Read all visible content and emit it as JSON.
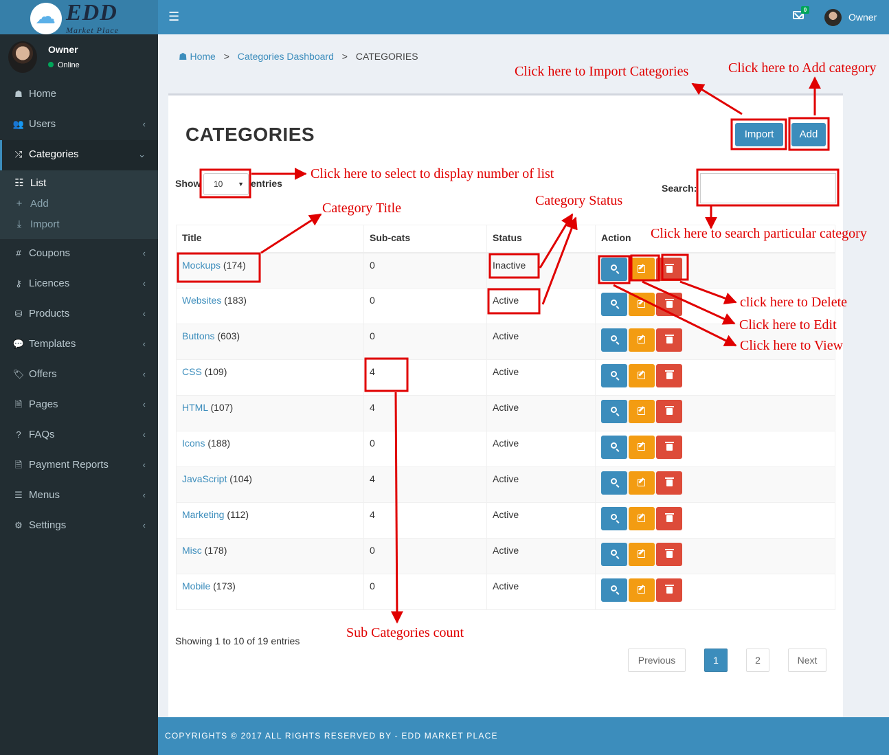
{
  "brand": {
    "main": "EDD",
    "sub": "Market Place"
  },
  "user": {
    "name": "Owner",
    "status": "Online"
  },
  "header": {
    "menu_icon": "hamburger-icon",
    "notification_count": "0",
    "user_name": "Owner"
  },
  "sidebar": {
    "items": [
      {
        "label": "Home",
        "icon": "home-icon",
        "glyph": "☗",
        "chevron": ""
      },
      {
        "label": "Users",
        "icon": "users-icon",
        "glyph": "👥",
        "chevron": "‹"
      },
      {
        "label": "Categories",
        "icon": "shuffle-icon",
        "glyph": "⤮",
        "chevron": "⌄"
      },
      {
        "label": "Coupons",
        "icon": "hashtag-icon",
        "glyph": "#",
        "chevron": "‹"
      },
      {
        "label": "Licences",
        "icon": "key-icon",
        "glyph": "⚷",
        "chevron": "‹"
      },
      {
        "label": "Products",
        "icon": "shopping-bag-icon",
        "glyph": "⛁",
        "chevron": "‹"
      },
      {
        "label": "Templates",
        "icon": "comment-icon",
        "glyph": "💬",
        "chevron": "‹"
      },
      {
        "label": "Offers",
        "icon": "tags-icon",
        "glyph": "🏷",
        "chevron": "‹"
      },
      {
        "label": "Pages",
        "icon": "file-icon",
        "glyph": "🗎",
        "chevron": "‹"
      },
      {
        "label": "FAQs",
        "icon": "question-icon",
        "glyph": "?",
        "chevron": "‹"
      },
      {
        "label": "Payment Reports",
        "icon": "file-text-icon",
        "glyph": "🗎",
        "chevron": "‹"
      },
      {
        "label": "Menus",
        "icon": "bars-icon",
        "glyph": "☰",
        "chevron": "‹"
      },
      {
        "label": "Settings",
        "icon": "gear-icon",
        "glyph": "⚙",
        "chevron": "‹"
      }
    ],
    "submenu": [
      {
        "label": "List",
        "icon": "list-icon",
        "glyph": "☷"
      },
      {
        "label": "Add",
        "icon": "plus-icon",
        "glyph": "+"
      },
      {
        "label": "Import",
        "icon": "download-icon",
        "glyph": "⤓"
      }
    ]
  },
  "breadcrumb": {
    "home": "Home",
    "dashboard": "Categories Dashboard",
    "current": "CATEGORIES",
    "separator": ">"
  },
  "page": {
    "title": "CATEGORIES",
    "import_label": "Import",
    "add_label": "Add"
  },
  "table_controls": {
    "show": "Show",
    "entries": "entries",
    "page_size": "10",
    "search_label": "Search:",
    "search_value": ""
  },
  "table": {
    "columns": [
      "Title",
      "Sub-cats",
      "Status",
      "Action"
    ],
    "rows": [
      {
        "title": "Mockups",
        "count": "(174)",
        "subcats": "0",
        "status": "Inactive"
      },
      {
        "title": "Websites",
        "count": "(183)",
        "subcats": "0",
        "status": "Active"
      },
      {
        "title": "Buttons",
        "count": "(603)",
        "subcats": "0",
        "status": "Active"
      },
      {
        "title": "CSS",
        "count": "(109)",
        "subcats": "4",
        "status": "Active"
      },
      {
        "title": "HTML",
        "count": "(107)",
        "subcats": "4",
        "status": "Active"
      },
      {
        "title": "Icons",
        "count": "(188)",
        "subcats": "0",
        "status": "Active"
      },
      {
        "title": "JavaScript",
        "count": "(104)",
        "subcats": "4",
        "status": "Active"
      },
      {
        "title": "Marketing",
        "count": "(112)",
        "subcats": "4",
        "status": "Active"
      },
      {
        "title": "Misc",
        "count": "(178)",
        "subcats": "0",
        "status": "Active"
      },
      {
        "title": "Mobile",
        "count": "(173)",
        "subcats": "0",
        "status": "Active"
      }
    ]
  },
  "pagination": {
    "info": "Showing 1 to 10 of 19 entries",
    "previous": "Previous",
    "next": "Next",
    "pages": [
      "1",
      "2"
    ],
    "current": "1"
  },
  "footer": {
    "text": "COPYRIGHTS © 2017 ALL RIGHTS RESERVED BY - EDD MARKET PLACE"
  },
  "annotations": {
    "import": "Click here to Import Categories",
    "add": "Click here to Add category",
    "page_size": "Click here to select to display number of list",
    "title": "Category Title",
    "status": "Category Status",
    "search": "Click here to search particular category",
    "delete": "click here to Delete",
    "edit": "Click here to Edit",
    "view": "Click here to View",
    "subcats": "Sub Categories count"
  },
  "colors": {
    "primary": "#3c8dbc",
    "sidebar": "#222d32",
    "warning": "#f39c12",
    "danger": "#dd4b39",
    "annotation": "#e00000"
  }
}
